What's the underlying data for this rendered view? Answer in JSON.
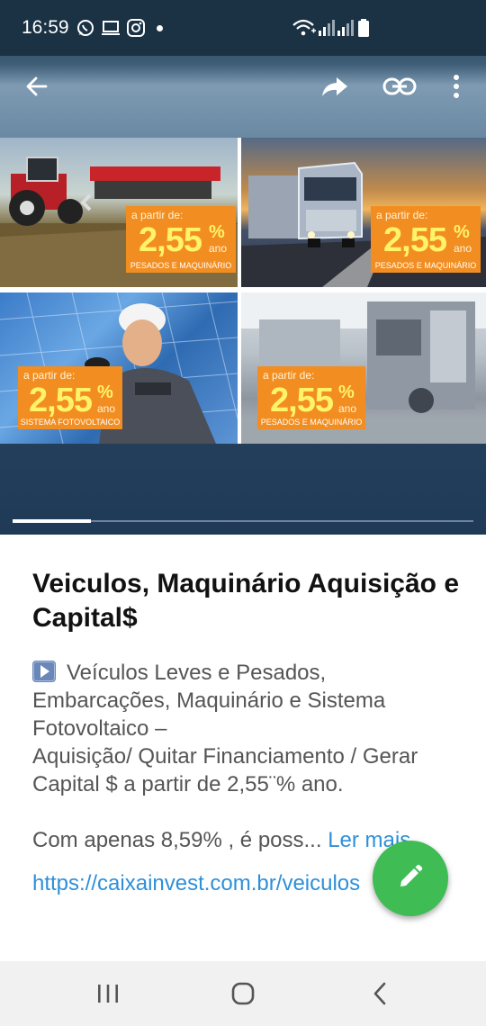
{
  "status_bar": {
    "time": "16:59",
    "icons": [
      "whatsapp-icon",
      "laptop-icon",
      "instagram-icon",
      "dot-icon",
      "wifi-icon",
      "signal-icon",
      "signal-icon",
      "battery-icon"
    ]
  },
  "action_bar": {
    "icons": [
      "back-arrow-icon",
      "share-icon",
      "link-icon",
      "more-vert-icon"
    ]
  },
  "collage": {
    "tiles": [
      {
        "from": "a partir de:",
        "rate": "2,55",
        "pct": "%",
        "ano": "ano",
        "category": "PESADOS E MAQUINÁRIO",
        "subject": "tractor"
      },
      {
        "from": "a partir de:",
        "rate": "2,55",
        "pct": "%",
        "ano": "ano",
        "category": "PESADOS E MAQUINÁRIO",
        "subject": "truck"
      },
      {
        "from": "a partir de:",
        "rate": "2,55",
        "pct": "%",
        "ano": "ano",
        "category": "SISTEMA FOTOVOLTAICO",
        "subject": "solar-panels"
      },
      {
        "from": "a partir de:",
        "rate": "2,55",
        "pct": "%",
        "ano": "ano",
        "category": "PESADOS E MAQUINÁRIO",
        "subject": "industrial-machinery"
      }
    ],
    "slide_progress": 0.17
  },
  "post": {
    "title": "Veiculos, Maquinário Aquisição e Capital$",
    "description_line1": "Veículos Leves e Pesados,",
    "description_rest": "Embarcações, Maquinário e Sistema Fotovoltaico –\nAquisição/ Quitar Financiamento / Gerar Capital $ a partir de 2,55¨% ano.",
    "more_text": "Com apenas 8,59% , é poss... ",
    "read_more": "Ler mais",
    "link": "https://caixainvest.com.br/veiculos"
  },
  "fab": {
    "icon": "pencil-icon"
  },
  "nav_bar": {
    "icons": [
      "recent-apps-icon",
      "home-icon",
      "back-icon"
    ]
  },
  "colors": {
    "accent_green": "#3fbc54",
    "link_blue": "#2f8fd8",
    "promo_orange": "#f28e21",
    "header_dark": "#1b3144"
  }
}
